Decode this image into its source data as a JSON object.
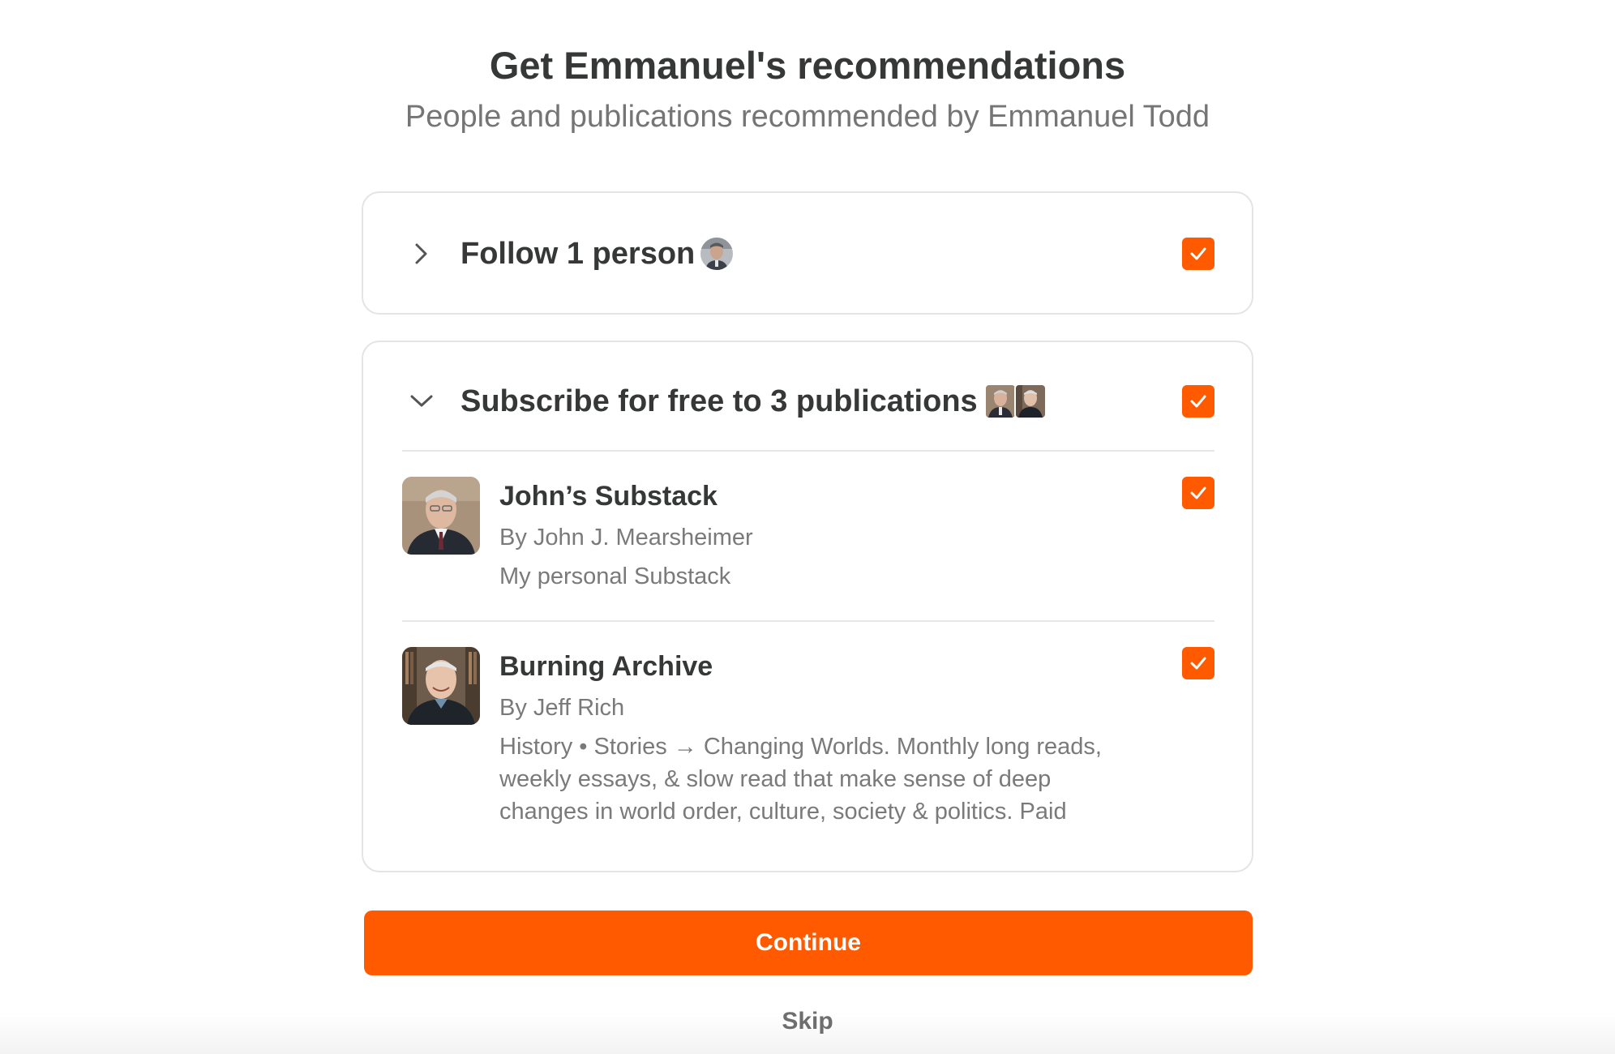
{
  "header": {
    "title": "Get Emmanuel's recommendations",
    "subtitle": "People and publications recommended by Emmanuel Todd"
  },
  "follow_section": {
    "label": "Follow 1 person",
    "expanded": false,
    "checked": true,
    "chevron_icon": "chevron-right-icon"
  },
  "subscribe_section": {
    "label": "Subscribe for free to 3 publications",
    "expanded": true,
    "checked": true,
    "chevron_icon": "chevron-down-icon",
    "publications": [
      {
        "name": "John’s Substack",
        "author": "By John J. Mearsheimer",
        "description": "My personal Substack",
        "checked": true
      },
      {
        "name": "Burning Archive",
        "author": "By Jeff Rich",
        "description": "History • Stories → Changing Worlds. Monthly long reads, weekly essays, & slow read that make sense of deep changes in world order, culture, society & politics. Paid",
        "checked": true
      }
    ]
  },
  "actions": {
    "continue_label": "Continue",
    "skip_label": "Skip"
  },
  "colors": {
    "accent": "#ff5a00",
    "text_primary": "#363737",
    "text_secondary": "#7a7a7a",
    "border": "#e4e4e4"
  }
}
